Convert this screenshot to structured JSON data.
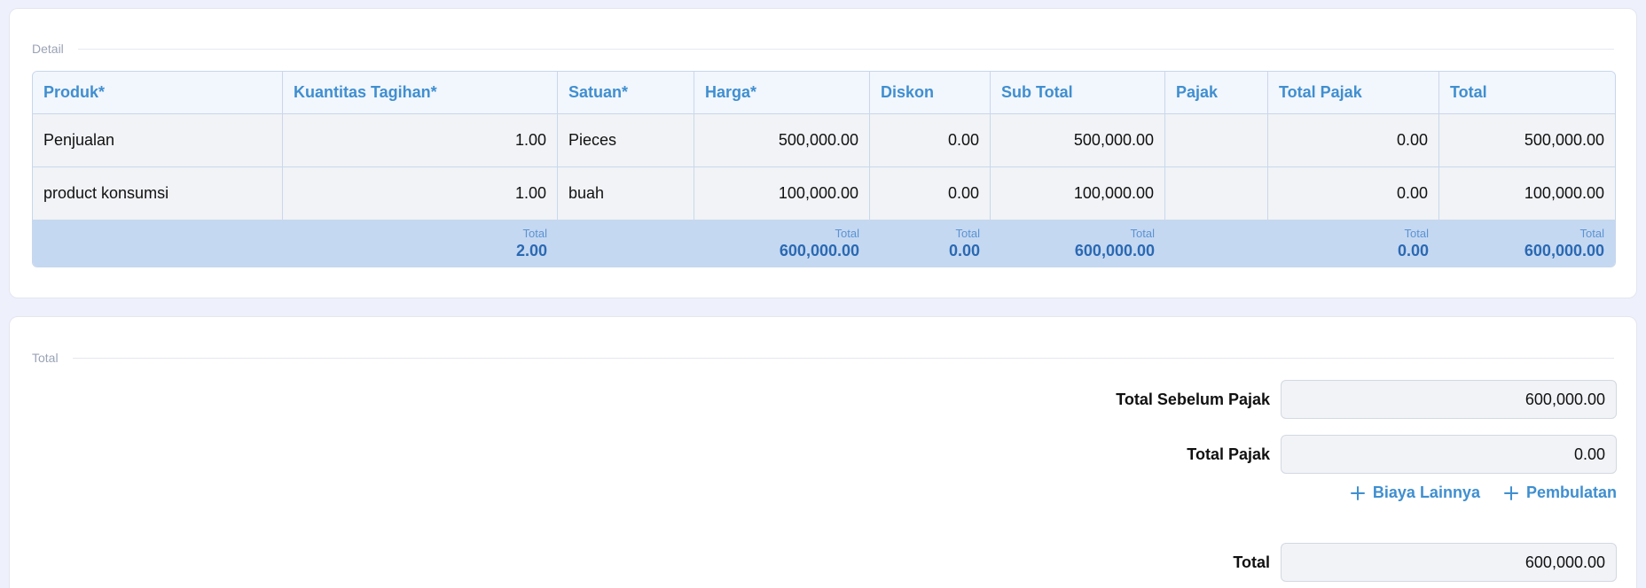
{
  "detail": {
    "section_label": "Detail",
    "columns": [
      "Produk*",
      "Kuantitas Tagihan*",
      "Satuan*",
      "Harga*",
      "Diskon",
      "Sub Total",
      "Pajak",
      "Total Pajak",
      "Total"
    ],
    "rows": [
      [
        "Penjualan",
        "1.00",
        "Pieces",
        "500,000.00",
        "0.00",
        "500,000.00",
        "",
        "0.00",
        "500,000.00"
      ],
      [
        "product konsumsi",
        "1.00",
        "buah",
        "100,000.00",
        "0.00",
        "100,000.00",
        "",
        "0.00",
        "100,000.00"
      ]
    ],
    "footer": {
      "label": "Total",
      "quantity": "2.00",
      "harga": "600,000.00",
      "diskon": "0.00",
      "sub_total": "600,000.00",
      "total_pajak": "0.00",
      "total": "600,000.00"
    }
  },
  "totals": {
    "section_label": "Total",
    "before_tax_label": "Total Sebelum Pajak",
    "before_tax_value": "600,000.00",
    "tax_label": "Total Pajak",
    "tax_value": "0.00",
    "other_costs_label": "Biaya Lainnya",
    "rounding_label": "Pembulatan",
    "total_label": "Total",
    "total_value": "600,000.00",
    "plus_icon": "plus-icon"
  },
  "colors": {
    "accent": "#3f8fd0",
    "footer_bg": "#c5d8f1",
    "footer_value": "#2a69b3",
    "page_bg": "#eef0fb"
  }
}
